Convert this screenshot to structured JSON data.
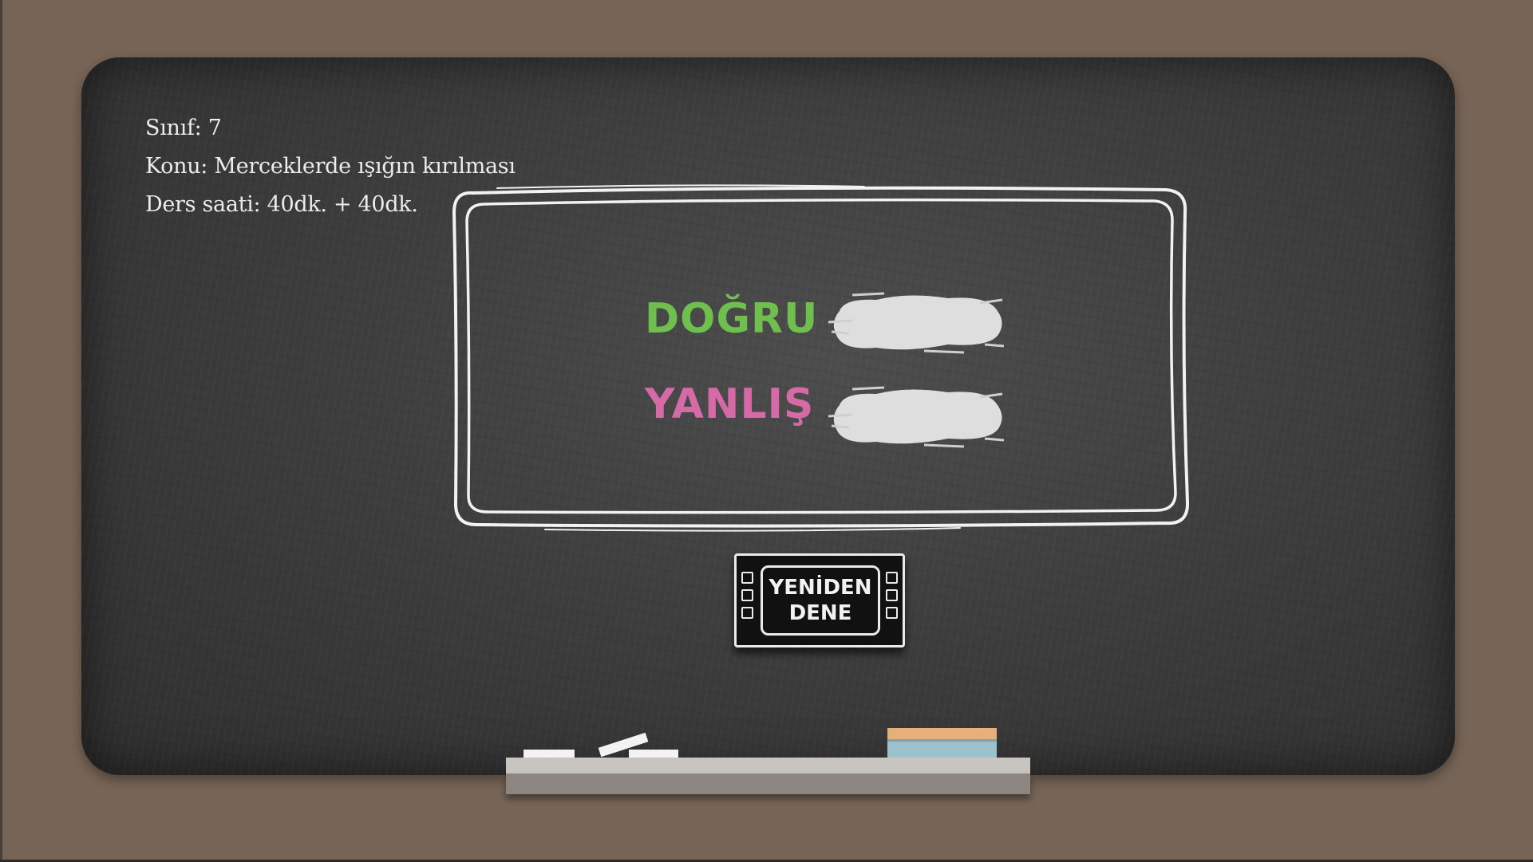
{
  "lesson_info": {
    "grade": "Sınıf: 7",
    "topic": "Konu: Merceklerde ışığın kırılması",
    "duration": "Ders saati: 40dk. + 40dk."
  },
  "results": {
    "correct_label": "DOĞRU",
    "wrong_label": "YANLIŞ"
  },
  "retry_button": {
    "line1": "YENİDEN",
    "line2": "DENE"
  },
  "colors": {
    "background": "#766456",
    "board": "#3e3e3e",
    "correct": "#6fbf4f",
    "wrong": "#d66aa6",
    "chalk": "#f3f3f3"
  }
}
